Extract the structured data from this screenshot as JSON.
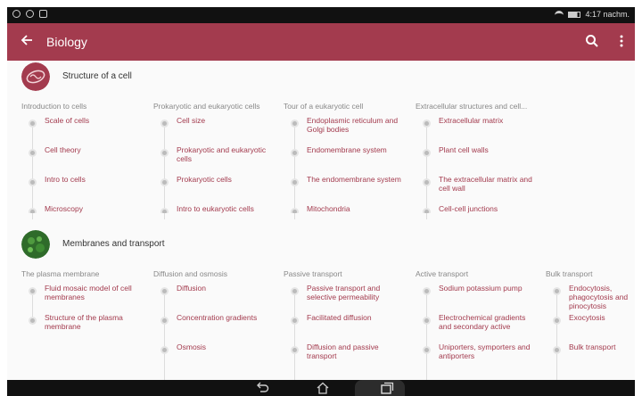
{
  "status_bar": {
    "time": "4:17 nachm."
  },
  "app_bar": {
    "title": "Biology"
  },
  "sections": [
    {
      "title": "Structure of a cell",
      "icon": "cell-structure-icon",
      "columns": [
        {
          "title": "Introduction to cells",
          "items": [
            "Scale of cells",
            "Cell theory",
            "Intro to cells",
            "Microscopy"
          ]
        },
        {
          "title": "Prokaryotic and eukaryotic cells",
          "items": [
            "Cell size",
            "Prokaryotic and eukaryotic cells",
            "Prokaryotic cells",
            "Intro to eukaryotic cells"
          ]
        },
        {
          "title": "Tour of a eukaryotic cell",
          "items": [
            "Endoplasmic reticulum and Golgi bodies",
            "Endomembrane system",
            "The endomembrane system",
            "Mitochondria"
          ]
        },
        {
          "title": "Extracellular structures and cell...",
          "items": [
            "Extracellular matrix",
            "Plant cell walls",
            "The extracellular matrix and cell wall",
            "Cell-cell junctions"
          ]
        }
      ]
    },
    {
      "title": "Membranes and transport",
      "icon": "membrane-transport-icon",
      "columns": [
        {
          "title": "The plasma membrane",
          "items": [
            "Fluid mosaic model of cell membranes",
            "Structure of the plasma membrane"
          ]
        },
        {
          "title": "Diffusion and osmosis",
          "items": [
            "Diffusion",
            "Concentration gradients",
            "Osmosis"
          ]
        },
        {
          "title": "Passive transport",
          "items": [
            "Passive transport and selective permeability",
            "Facilitated diffusion",
            "Diffusion and passive transport"
          ]
        },
        {
          "title": "Active transport",
          "items": [
            "Sodium potassium pump",
            "Electrochemical gradients and secondary active",
            "Uniporters, symporters and antiporters"
          ]
        },
        {
          "title": "Bulk transport",
          "items": [
            "Endocytosis, phagocytosis and pinocytosis",
            "Exocytosis",
            "Bulk transport"
          ]
        }
      ]
    }
  ],
  "colors": {
    "accent": "#a33b4e",
    "header_text": "#ffffff",
    "muted": "#888888"
  }
}
